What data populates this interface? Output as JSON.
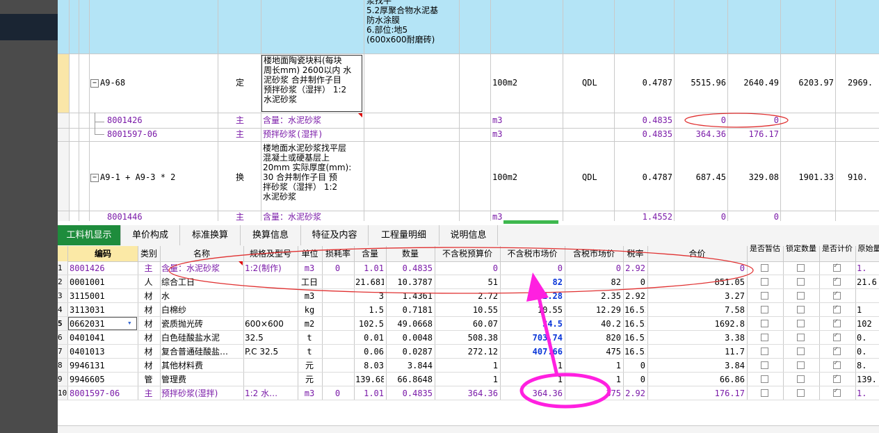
{
  "upper": {
    "row0_desc_lines": [
      "浆找平",
      "5.2厚聚合物水泥基",
      "防水涂膜",
      "6.部位:地5",
      "(600x600耐磨砖)"
    ],
    "row1": {
      "code": "A9-68",
      "cat": "定",
      "desc_lines": [
        "楼地面陶瓷块料(每块",
        "周长mm) 2600以内 水",
        "泥砂浆  合并制作子目",
        "预拌砂浆（湿拌） 1:2",
        "水泥砂浆"
      ],
      "unit": "100m2",
      "expr": "QDL",
      "qty": "0.4787",
      "p1": "5515.96",
      "p2": "2640.49",
      "p3": "6203.97",
      "p4": "2969."
    },
    "row2": {
      "code": "8001426",
      "cat": "主",
      "name": "含量：水泥砂浆",
      "unit": "m3",
      "qty": "0.4835",
      "p1": "0",
      "p2": "0"
    },
    "row3": {
      "code": "8001597-06",
      "cat": "主",
      "name": "预拌砂浆(湿拌)",
      "unit": "m3",
      "qty": "0.4835",
      "p1": "364.36",
      "p2": "176.17"
    },
    "row4": {
      "code": "A9-1 + A9-3 * 2",
      "cat": "换",
      "desc_lines": [
        "楼地面水泥砂浆找平层",
        "混凝土或硬基层上",
        "20mm  实际厚度(mm):",
        "30  合并制作子目 预",
        "拌砂浆（湿拌） 1:2",
        "水泥砂浆"
      ],
      "unit": "100m2",
      "expr": "QDL",
      "qty": "0.4787",
      "p1": "687.45",
      "p2": "329.08",
      "p3": "1901.33",
      "p4": "910."
    },
    "row5": {
      "code": "8001446",
      "cat": "主",
      "name": "含量：水泥砂浆",
      "unit": "m3",
      "qty": "1.4552",
      "p1": "0",
      "p2": "0"
    }
  },
  "tabs": [
    "工料机显示",
    "单价构成",
    "标准换算",
    "换算信息",
    "特征及内容",
    "工程量明细",
    "说明信息"
  ],
  "headers": [
    "编码",
    "类别",
    "名称",
    "规格及型号",
    "单位",
    "损耗率",
    "含量",
    "数量",
    "不含税预算价",
    "不含税市场价",
    "含税市场价",
    "税率",
    "合价",
    "是否暂估",
    "锁定数量",
    "是否计价",
    "原始量"
  ],
  "rows": [
    {
      "n": "1",
      "code": "8001426",
      "cat": "主",
      "name": "含量：水泥砂浆",
      "spec": "1:2(制作)",
      "unit": "m3",
      "loss": "0",
      "content": "1.01",
      "qty": "0.4835",
      "budget": "0",
      "market": "0",
      "taxed": "0",
      "rate": "2.92",
      "total": "0",
      "zg": false,
      "sd": false,
      "jj": true,
      "orig": "1."
    },
    {
      "n": "2",
      "code": "0001001",
      "cat": "人",
      "name": "综合工日",
      "spec": "",
      "unit": "工日",
      "loss": "",
      "content": "21.681",
      "qty": "10.3787",
      "budget": "51",
      "market": "82",
      "taxed": "82",
      "rate": "0",
      "total": "851.05",
      "zg": false,
      "sd": false,
      "jj": true,
      "orig": "21.6"
    },
    {
      "n": "3",
      "code": "3115001",
      "cat": "材",
      "name": "水",
      "spec": "",
      "unit": "m3",
      "loss": "",
      "content": "3",
      "qty": "1.4361",
      "budget": "2.72",
      "market": "2.28",
      "taxed": "2.35",
      "rate": "2.92",
      "total": "3.27",
      "zg": false,
      "sd": false,
      "jj": true,
      "orig": ""
    },
    {
      "n": "4",
      "code": "3113031",
      "cat": "材",
      "name": "白棉纱",
      "spec": "",
      "unit": "kg",
      "loss": "",
      "content": "1.5",
      "qty": "0.7181",
      "budget": "10.55",
      "market": "10.55",
      "taxed": "12.29",
      "rate": "16.52",
      "total": "7.58",
      "zg": false,
      "sd": false,
      "jj": true,
      "orig": "1"
    },
    {
      "n": "5",
      "code": "0662031",
      "cat": "材",
      "name": "瓷质抛光砖",
      "spec": "600×600",
      "unit": "m2",
      "loss": "",
      "content": "102.5",
      "qty": "49.0668",
      "budget": "60.07",
      "market": "34.5",
      "taxed": "40.2",
      "rate": "16.52",
      "total": "1692.8",
      "zg": false,
      "sd": false,
      "jj": true,
      "orig": "102"
    },
    {
      "n": "6",
      "code": "0401041",
      "cat": "材",
      "name": "白色硅酸盐水泥",
      "spec": "32.5",
      "unit": "t",
      "loss": "",
      "content": "0.01",
      "qty": "0.0048",
      "budget": "508.38",
      "market": "703.74",
      "taxed": "820",
      "rate": "16.52",
      "total": "3.38",
      "zg": false,
      "sd": false,
      "jj": true,
      "orig": "0."
    },
    {
      "n": "7",
      "code": "0401013",
      "cat": "材",
      "name": "复合普通硅酸盐…",
      "spec": "P.C 32.5",
      "unit": "t",
      "loss": "",
      "content": "0.06",
      "qty": "0.0287",
      "budget": "272.12",
      "market": "407.66",
      "taxed": "475",
      "rate": "16.52",
      "total": "11.7",
      "zg": false,
      "sd": false,
      "jj": true,
      "orig": "0."
    },
    {
      "n": "8",
      "code": "9946131",
      "cat": "材",
      "name": "其他材料费",
      "spec": "",
      "unit": "元",
      "loss": "",
      "content": "8.03",
      "qty": "3.844",
      "budget": "1",
      "market": "1",
      "taxed": "1",
      "rate": "0",
      "total": "3.84",
      "zg": false,
      "sd": false,
      "jj": true,
      "orig": "8."
    },
    {
      "n": "9",
      "code": "9946605",
      "cat": "管",
      "name": "管理费",
      "spec": "",
      "unit": "元",
      "loss": "",
      "content": "139.68",
      "qty": "66.8648",
      "budget": "1",
      "market": "1",
      "taxed": "1",
      "rate": "0",
      "total": "66.86",
      "zg": false,
      "sd": false,
      "jj": true,
      "orig": "139."
    },
    {
      "n": "10",
      "code": "8001597-06",
      "cat": "主",
      "name": "预拌砂浆(湿拌)",
      "spec": "1:2 水…",
      "unit": "m3",
      "loss": "0",
      "content": "1.01",
      "qty": "0.4835",
      "budget": "364.36",
      "market": "364.36",
      "taxed": "375",
      "rate": "2.92",
      "total": "176.17",
      "zg": false,
      "sd": false,
      "jj": true,
      "orig": "1."
    }
  ],
  "colors": {
    "header_bg": "#b4e4f6",
    "tab_active": "#1e8c3c",
    "purple_text": "#7a1aa8",
    "blue_text": "#0a36d8",
    "annotation_red": "#e03030",
    "annotation_magenta": "#ff20e0"
  }
}
